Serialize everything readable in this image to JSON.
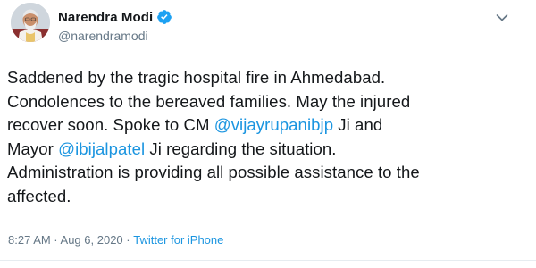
{
  "author": {
    "display_name": "Narendra Modi",
    "handle": "@narendramodi",
    "verified": true,
    "avatar_icon": "profile-photo"
  },
  "colors": {
    "text": "#14171a",
    "secondary": "#657786",
    "link": "#1b95e0",
    "verified_badge": "#1da1f2"
  },
  "tweet": {
    "line1": "Saddened by the tragic hospital fire in Ahmedabad.",
    "line2": "Condolences to the bereaved families. May the injured",
    "line3_pre": "recover soon. Spoke to CM ",
    "mention1": "@vijayrupanibjp",
    "line3_post": " Ji and",
    "line4_pre": "Mayor ",
    "mention2": "@ibijalpatel",
    "line4_post": " Ji regarding the situation.",
    "line5": "Administration is providing all possible assistance to the",
    "line6": "affected."
  },
  "meta": {
    "timestamp": "8:27 AM · Aug 6, 2020",
    "separator": " · ",
    "source": "Twitter for iPhone"
  },
  "menu": {
    "icon": "chevron-down-icon"
  }
}
